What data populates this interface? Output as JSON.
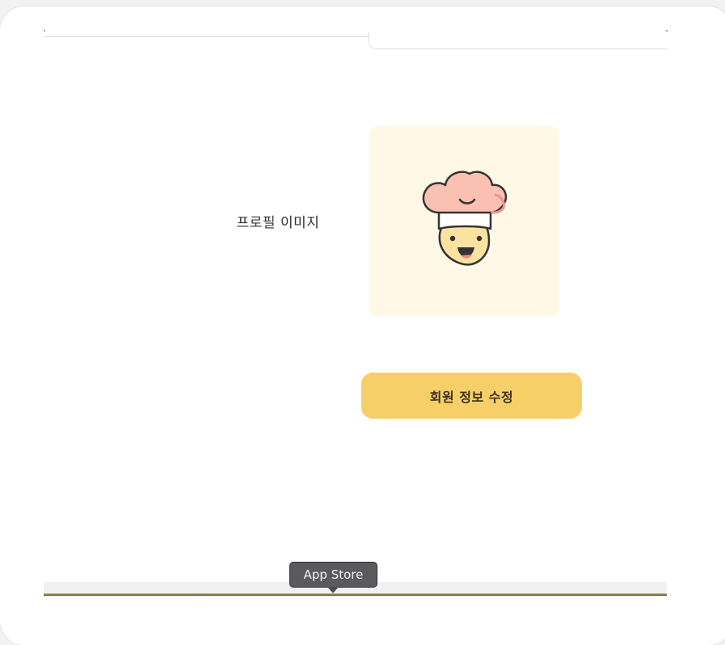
{
  "profile": {
    "label": "프로필 이미지",
    "avatar_icon": "chef-hat-smiley-icon",
    "avatar_background": "#fff8e6"
  },
  "actions": {
    "edit_label": "회원 정보 수정",
    "edit_color": "#f7cf69"
  },
  "dock": {
    "tooltip": "App Store"
  }
}
